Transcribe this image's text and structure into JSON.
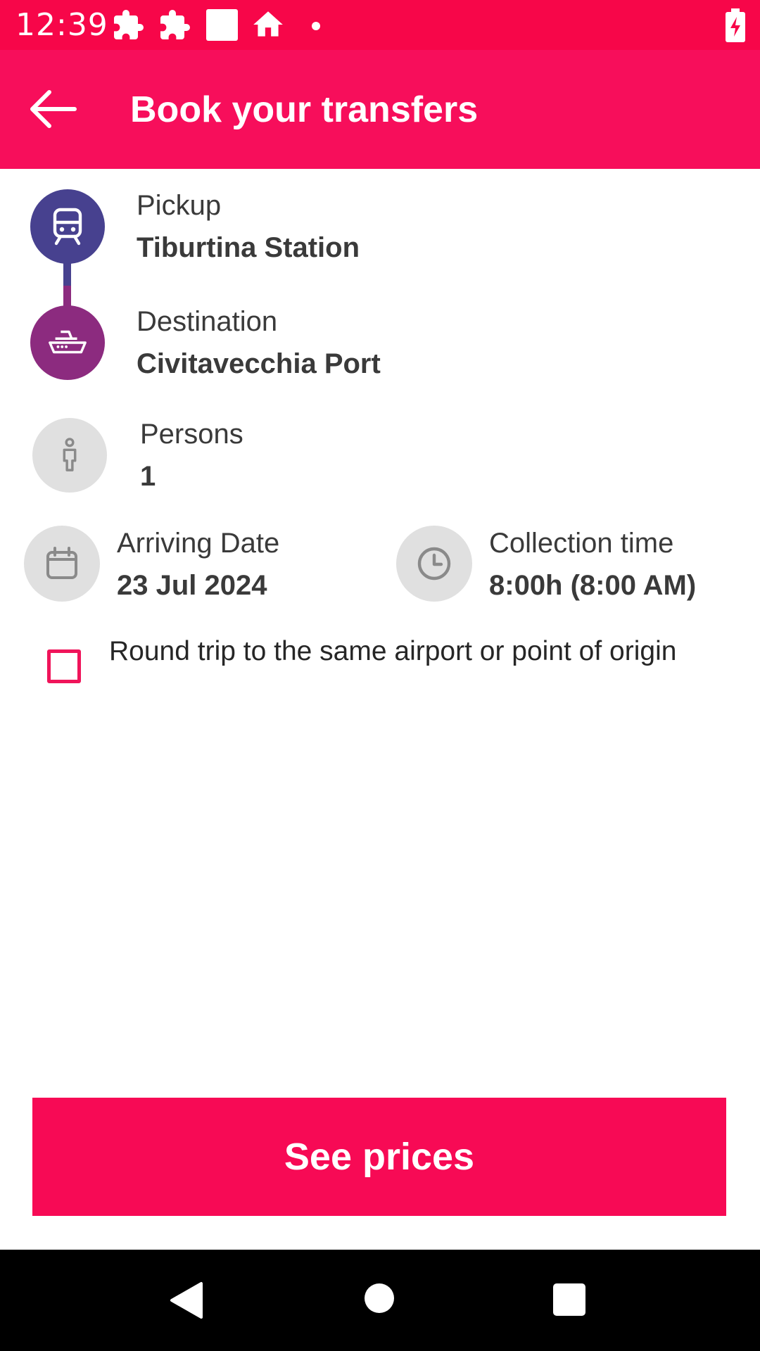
{
  "status_bar": {
    "time": "12:39",
    "icons": [
      "puzzle-icon",
      "puzzle-icon",
      "square-icon",
      "home-icon",
      "dot-icon",
      "battery-charging-icon"
    ]
  },
  "app_bar": {
    "title": "Book your transfers",
    "back_icon": "arrow-left-icon"
  },
  "route": {
    "pickup": {
      "label": "Pickup",
      "value": "Tiburtina Station",
      "icon": "train-icon",
      "color": "#47418f"
    },
    "destination": {
      "label": "Destination",
      "value": "Civitavecchia Port",
      "icon": "ship-icon",
      "color": "#8c2b7f"
    }
  },
  "persons": {
    "label": "Persons",
    "value": "1",
    "icon": "person-icon"
  },
  "arriving_date": {
    "label": "Arriving Date",
    "value": "23 Jul 2024",
    "icon": "calendar-icon"
  },
  "collection_time": {
    "label": "Collection time",
    "value": "8:00h (8:00 AM)",
    "icon": "clock-icon"
  },
  "round_trip": {
    "label": "Round trip to the same airport or point of origin",
    "checked": false
  },
  "cta": {
    "label": "See prices"
  },
  "colors": {
    "accent": "#f70e5b",
    "status_bar": "#f70649",
    "icon_bg": "#e0e0e0",
    "icon_gray": "#8a8a8a"
  },
  "nav_bar": {
    "buttons": [
      "back-triangle-icon",
      "home-circle-icon",
      "recents-square-icon"
    ]
  }
}
